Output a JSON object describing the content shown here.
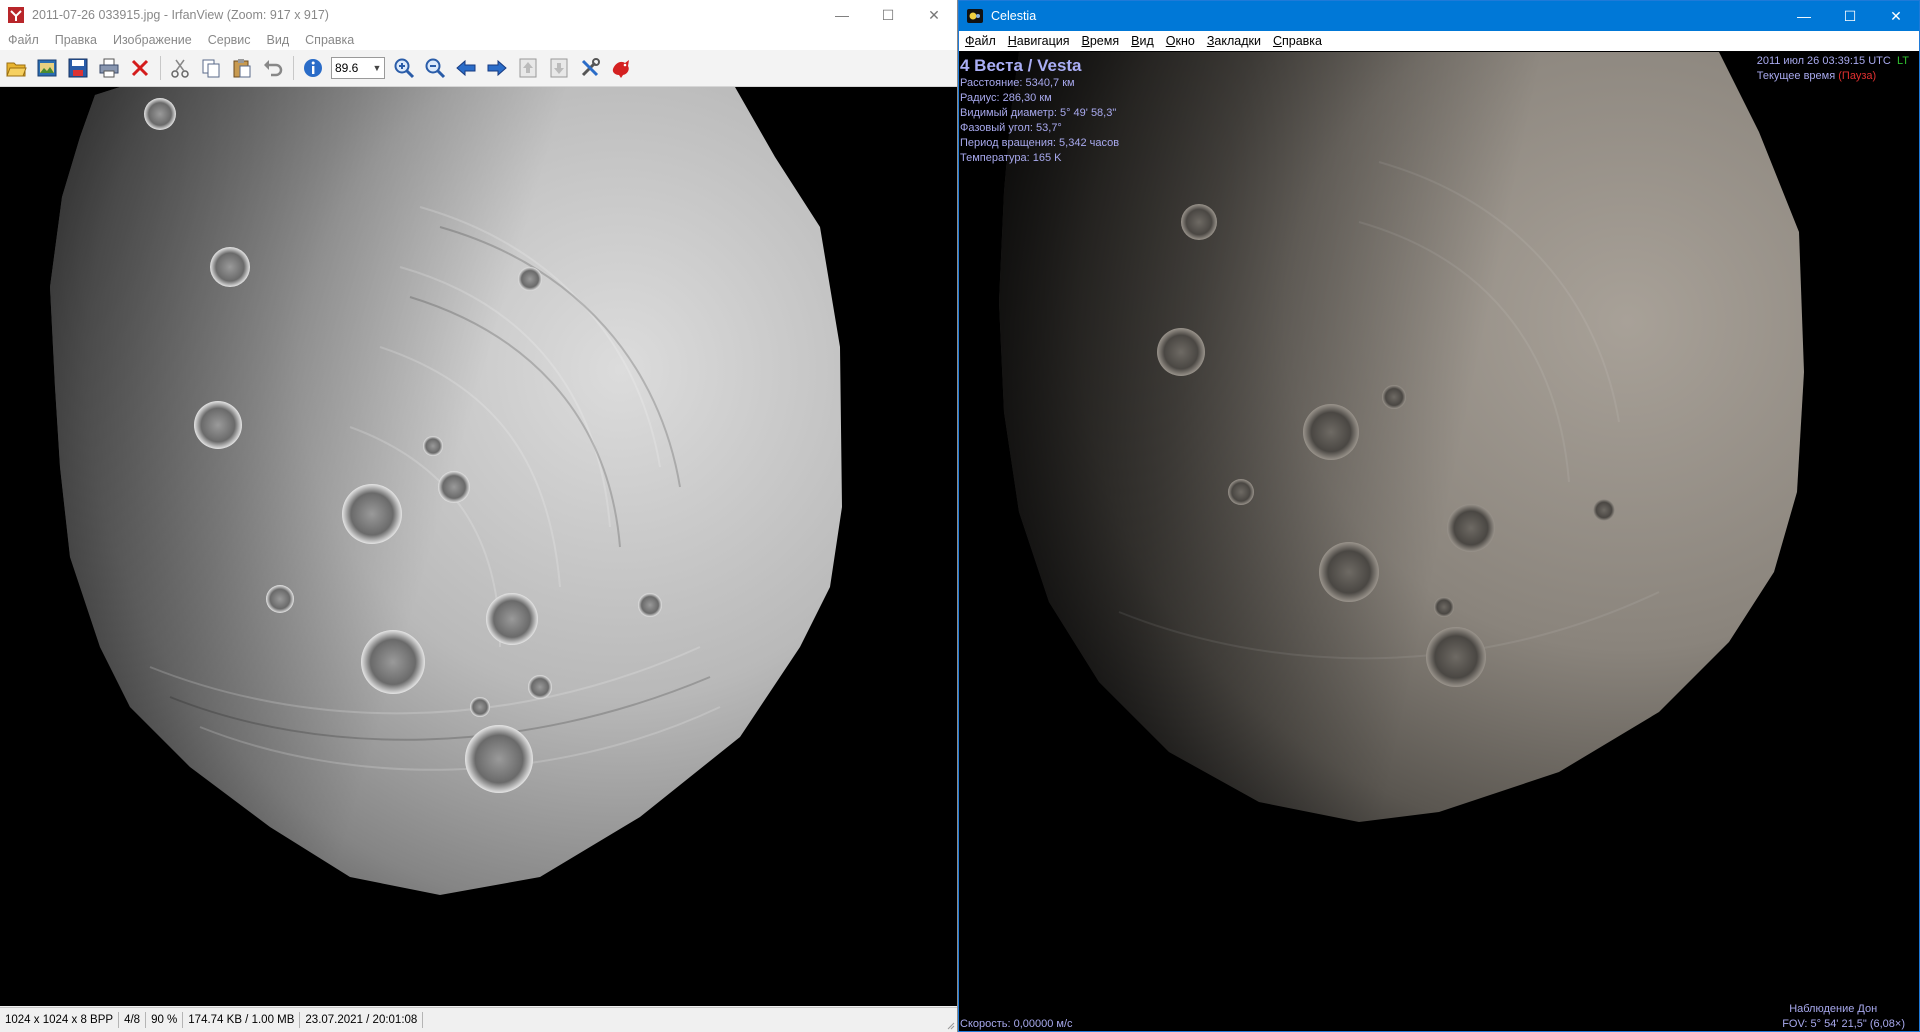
{
  "irfanview": {
    "title": "2011-07-26 033915.jpg - IrfanView (Zoom: 917 x 917)",
    "window_controls": {
      "minimize": "—",
      "maximize": "☐",
      "close": "✕"
    },
    "menu": [
      "Файл",
      "Правка",
      "Изображение",
      "Сервис",
      "Вид",
      "Справка"
    ],
    "toolbar": {
      "zoom_value": "89.6",
      "icons": [
        "open-folder-icon",
        "thumbnails-icon",
        "save-icon",
        "print-icon",
        "delete-icon",
        "cut-icon",
        "copy-icon",
        "paste-icon",
        "undo-icon",
        "info-icon",
        "zoom-in-icon",
        "zoom-out-icon",
        "previous-icon",
        "next-icon",
        "page-up-icon",
        "page-down-icon",
        "settings-icon",
        "irfanview-logo-icon"
      ]
    },
    "status": {
      "dimensions": "1024 x 1024 x 8 BPP",
      "index": "4/8",
      "zoom": "90 %",
      "size": "174.74 KB / 1.00 MB",
      "date": "23.07.2021 / 20:01:08"
    }
  },
  "celestia": {
    "title": "Celestia",
    "window_controls": {
      "minimize": "—",
      "maximize": "☐",
      "close": "✕"
    },
    "menu": [
      "Файл",
      "Навигация",
      "Время",
      "Вид",
      "Окно",
      "Закладки",
      "Справка"
    ],
    "hud": {
      "object_name": "4 Веста / Vesta",
      "distance": "Расстояние: 5340,7 км",
      "radius": "Радиус: 286,30 км",
      "apparent_diameter": "Видимый диаметр: 5° 49' 58,3\"",
      "phase_angle": "Фазовый угол: 53,7°",
      "rotation_period": "Период вращения: 5,342 часов",
      "temperature": "Температура: 165 K",
      "datetime": "2011 июл 26 03:39:15 UTC",
      "lt": "LT",
      "time_mode": "Текущее время",
      "paused": "(Пауза)",
      "speed": "Скорость: 0,00000 м/с",
      "observer": "Наблюдение Дон",
      "fov": "FOV: 5° 54' 21,5\" (6,08×)"
    }
  }
}
